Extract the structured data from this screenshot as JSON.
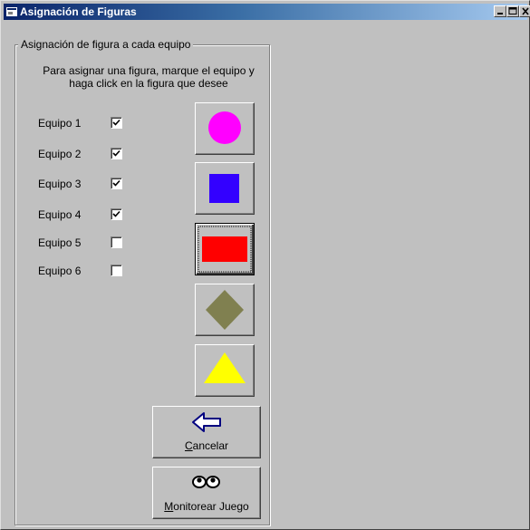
{
  "window": {
    "title": "Asignación de Figuras",
    "controls": [
      "minimize-icon",
      "maximize-icon",
      "close-icon"
    ]
  },
  "group": {
    "legend": "Asignación de figura a cada equipo",
    "instructions_line1": "Para asignar una figura, marque el equipo y",
    "instructions_line2": "haga click en la figura que desee"
  },
  "teams": [
    {
      "label": "Equipo 1",
      "checked": true
    },
    {
      "label": "Equipo 2",
      "checked": true
    },
    {
      "label": "Equipo 3",
      "checked": true
    },
    {
      "label": "Equipo 4",
      "checked": true
    },
    {
      "label": "Equipo 5",
      "checked": false
    },
    {
      "label": "Equipo 6",
      "checked": false
    }
  ],
  "shapes": [
    {
      "name": "circle",
      "color": "#ff00ff"
    },
    {
      "name": "square",
      "color": "#3300ff"
    },
    {
      "name": "rectangle",
      "color": "#ff0000",
      "focused": true
    },
    {
      "name": "diamond",
      "color": "#808050"
    },
    {
      "name": "triangle",
      "color": "#ffff00"
    }
  ],
  "buttons": {
    "cancel": {
      "accel": "C",
      "rest": "ancelar",
      "icon": "back-arrow-icon"
    },
    "monitor": {
      "accel": "M",
      "rest": "onitorear Juego",
      "icon": "eyes-icon"
    }
  }
}
